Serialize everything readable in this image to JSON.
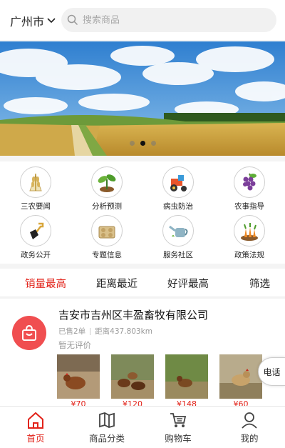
{
  "header": {
    "city": "广州市",
    "search_placeholder": "搜索商品"
  },
  "banner": {
    "active_slide": 1,
    "slide_count": 3
  },
  "categories": [
    {
      "label": "三农要闻",
      "icon": "wheat-icon"
    },
    {
      "label": "分析预测",
      "icon": "sprout-icon"
    },
    {
      "label": "病虫防治",
      "icon": "tractor-icon"
    },
    {
      "label": "农事指导",
      "icon": "grapes-icon"
    },
    {
      "label": "政务公开",
      "icon": "shovel-icon"
    },
    {
      "label": "专题信息",
      "icon": "seedling-tray-icon"
    },
    {
      "label": "服务社区",
      "icon": "watering-can-icon"
    },
    {
      "label": "政策法规",
      "icon": "carrot-icon"
    }
  ],
  "sort": {
    "options": [
      "销量最高",
      "距离最近",
      "好评最高",
      "筛选"
    ],
    "active": 0
  },
  "store": {
    "name": "吉安市吉州区丰盈畜牧有限公司",
    "sold": "已售2单",
    "distance": "距离437.803km",
    "rating": "暂无评价",
    "products": [
      {
        "price": "¥70"
      },
      {
        "price": "¥120"
      },
      {
        "price": "¥148"
      },
      {
        "price": "¥60"
      }
    ]
  },
  "phone_button": "电话",
  "tabbar": {
    "items": [
      "首页",
      "商品分类",
      "购物车",
      "我的"
    ],
    "active": 0
  },
  "colors": {
    "accent": "#e2231a",
    "store_logo": "#f04e50"
  }
}
